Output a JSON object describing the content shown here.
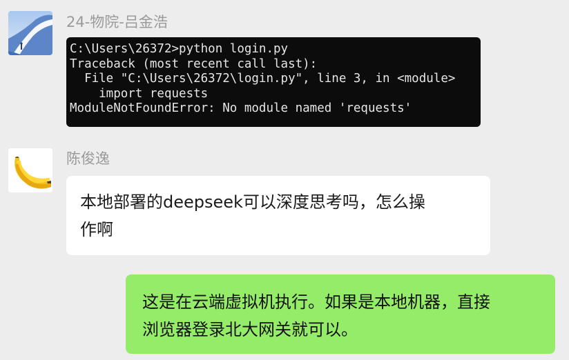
{
  "messages": [
    {
      "sender": "24-物院-吕金浩",
      "avatar": "landscape-avatar",
      "type": "image",
      "terminal_lines": [
        "C:\\Users\\26372>python login.py",
        "Traceback (most recent call last):",
        "  File \"C:\\Users\\26372\\login.py\", line 3, in <module>",
        "    import requests",
        "ModuleNotFoundError: No module named 'requests'"
      ]
    },
    {
      "sender": "陈俊逸",
      "avatar": "banana-avatar",
      "type": "text",
      "lines": [
        "本地部署的deepseek可以深度思考吗，怎么操",
        "作啊"
      ]
    },
    {
      "sender": "",
      "avatar": "",
      "type": "text",
      "outgoing": true,
      "lines": [
        "这是在云端虚拟机执行。如果是本地机器，直接",
        "浏览器登录北大网关就可以。"
      ]
    }
  ],
  "colors": {
    "background": "#ededed",
    "incoming_bubble": "#ffffff",
    "outgoing_bubble": "#95ec69",
    "terminal_bg": "#0c0c0c",
    "sender_name": "#9a9a9a"
  }
}
